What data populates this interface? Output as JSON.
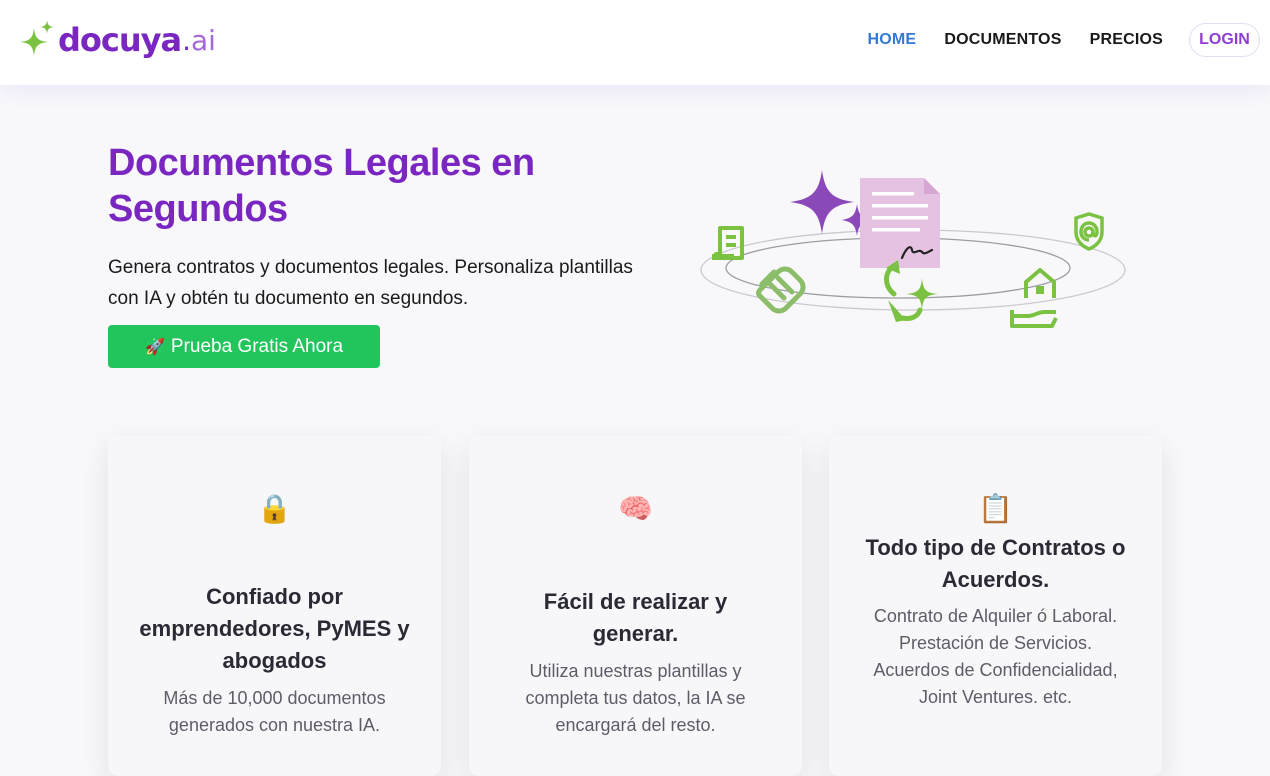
{
  "brand": {
    "name": "docuya",
    "dot": ".",
    "suffix": "ai",
    "icon": "sparkle-icon",
    "colors": {
      "purple": "#7a26c1",
      "green": "#7cc242",
      "cta_green": "#22c45c",
      "nav_active": "#3578d6"
    }
  },
  "nav": {
    "items": [
      {
        "label": "HOME",
        "active": true
      },
      {
        "label": "DOCUMENTOS",
        "active": false
      },
      {
        "label": "PRECIOS",
        "active": false
      }
    ],
    "login_label": "LOGIN"
  },
  "hero": {
    "title": "Documentos Legales en Segundos",
    "subtitle": "Genera contratos y documentos legales. Personaliza plantillas con IA y obtén tu documento en segundos.",
    "cta_icon": "🚀",
    "cta_label": "Prueba Gratis Ahora"
  },
  "illustration": {
    "icons": [
      "sparkle-icon",
      "document-icon",
      "receipt-icon",
      "shield-at-icon",
      "handshake-icon",
      "refresh-sparkle-icon",
      "house-hand-icon"
    ]
  },
  "cards": [
    {
      "emoji": "🔒",
      "title": "Confiado por emprendedores, PyMES y abogados",
      "text": "Más de 10,000 documentos generados con nuestra IA."
    },
    {
      "emoji": "🧠",
      "title": "Fácil de realizar y generar.",
      "text": "Utiliza nuestras plantillas y completa tus datos, la IA se encargará del resto."
    },
    {
      "emoji": "📋",
      "title": "Todo tipo de Contratos o Acuerdos.",
      "text": "Contrato de Alquiler ó Laboral. Prestación de Servicios. Acuerdos de Confidencialidad, Joint Ventures. etc."
    }
  ]
}
